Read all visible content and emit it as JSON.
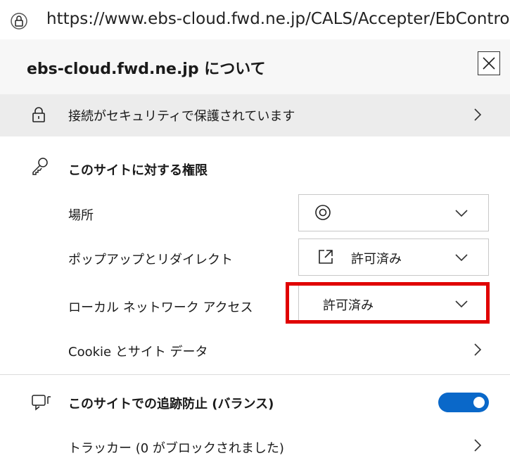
{
  "address_bar": {
    "url": "https://www.ebs-cloud.fwd.ne.jp/CALS/Accepter/EbControl"
  },
  "panel": {
    "title": "ebs-cloud.fwd.ne.jp について",
    "connection_label": "接続がセキュリティで保護されています",
    "permissions_title": "このサイトに対する権限",
    "permissions": [
      {
        "label": "場所",
        "value": "",
        "icon": "location-icon"
      },
      {
        "label": "ポップアップとリダイレクト",
        "value": "許可済み",
        "icon": "external-link-icon"
      },
      {
        "label": "ローカル ネットワーク アクセス",
        "value": "許可済み",
        "highlighted": true
      }
    ],
    "cookies_label": "Cookie とサイト データ",
    "tracking_title": "このサイトでの追跡防止 (バランス)",
    "tracking_enabled": true,
    "trackers_label": "トラッカー (0 がブロックされました)"
  },
  "colors": {
    "toggle": "#0a68c9",
    "highlight": "#e00000"
  }
}
